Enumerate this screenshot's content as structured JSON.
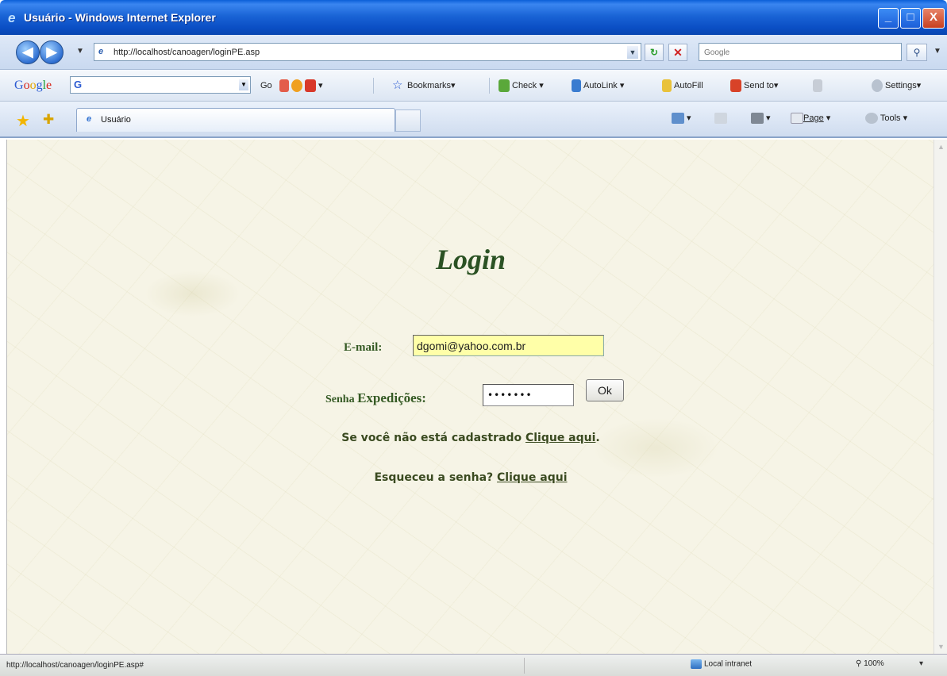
{
  "window": {
    "title": "Usuário - Windows Internet Explorer",
    "buttons": {
      "minimize": "_",
      "maximize": "□",
      "close": "X"
    }
  },
  "address_bar": {
    "url": "http://localhost/canoagen/loginPE.asp",
    "search_placeholder": "Google"
  },
  "google_toolbar": {
    "logo": [
      "G",
      "o",
      "o",
      "g",
      "l",
      "e"
    ],
    "search_prefix": "G",
    "go_label": "Go",
    "bookmarks_label": "Bookmarks",
    "check_label": "Check",
    "autolink_label": "AutoLink",
    "autofill_label": "AutoFill",
    "sendto_label": "Send to",
    "settings_label": "Settings"
  },
  "tabs": [
    {
      "label": "Usuário"
    }
  ],
  "command_bar": {
    "page_label": "Page",
    "tools_label": "Tools"
  },
  "page": {
    "title": "Login",
    "email_label": "E-mail:",
    "email_value": "dgomi@yahoo.com.br",
    "password_label_prefix": "Senha",
    "password_label_main": "Expedições:",
    "password_value": "*******",
    "ok_label": "Ok",
    "signup_text": "Se você não está cadastrado",
    "signup_link": "Clique aqui",
    "signup_end": ".",
    "forgot_text": "Esqueceu a senha?",
    "forgot_link": "Clique aqui"
  },
  "status_bar": {
    "url": "http://localhost/canoagen/loginPE.asp#",
    "zone": "Local intranet",
    "zoom": "100%"
  },
  "colors": {
    "title_bar": "#1a64d6",
    "page_background": "#f6f4e6",
    "heading": "#2b5224",
    "email_highlight": "#ffffa8",
    "label_text": "#355a24"
  }
}
